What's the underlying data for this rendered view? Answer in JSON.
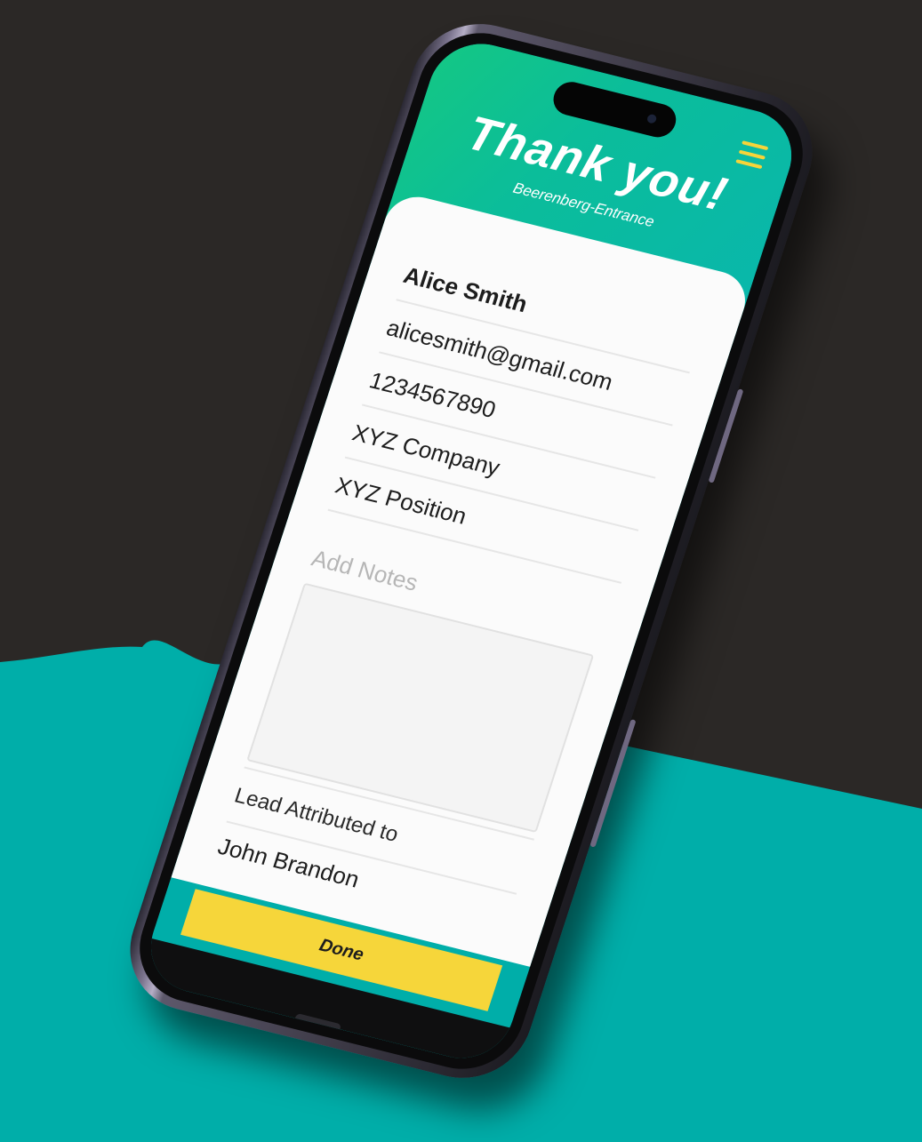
{
  "header": {
    "title": "Thank you!",
    "subtitle": "Beerenberg-Entrance",
    "menu_icon": "hamburger-menu-icon"
  },
  "form": {
    "name": "Alice Smith",
    "email": "alicesmith@gmail.com",
    "phone": "1234567890",
    "company": "XYZ Company",
    "position": "XYZ Position",
    "notes_placeholder": "Add Notes",
    "lead_label": "Lead Attributed to",
    "lead_name": "John Brandon"
  },
  "footer": {
    "done_label": "Done"
  },
  "colors": {
    "background": "#2b2826",
    "teal": "#00aea9",
    "header_green": "#14c784",
    "accent_yellow": "#f6d63a"
  }
}
